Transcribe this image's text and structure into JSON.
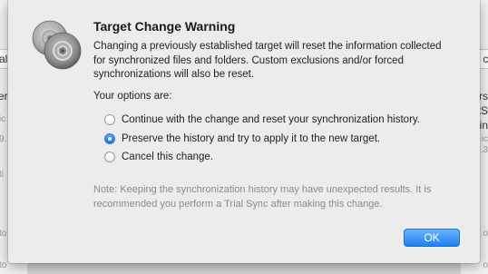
{
  "background": {
    "left_field_text": "cal",
    "right_field_text": "ca",
    "left_fragments": [
      "ers",
      "ic",
      "9.",
      "ti",
      "to",
      "to"
    ],
    "right_fragments": [
      "rs",
      "ertS",
      "ncin",
      "ic",
      "9.3",
      "o",
      "o"
    ]
  },
  "dialog": {
    "title": "Target Change Warning",
    "message": "Changing a previously established target will reset the information collected for synchronized files and folders. Custom exclusions and/or forced synchronizations will also be reset.",
    "options_label": "Your options are:",
    "options": [
      {
        "label": "Continue with the change and reset your synchronization history.",
        "selected": false
      },
      {
        "label": "Preserve the history and try to apply it to the new target.",
        "selected": true
      },
      {
        "label": "Cancel this change.",
        "selected": false
      }
    ],
    "note": "Note: Keeping the synchronization history may have unexpected results. It is recommended you perform a Trial Sync after making this change.",
    "ok_label": "OK",
    "icon": "sync-disks-icon"
  },
  "colors": {
    "accent": "#1f80f2",
    "note_text": "#8a8a8a"
  }
}
